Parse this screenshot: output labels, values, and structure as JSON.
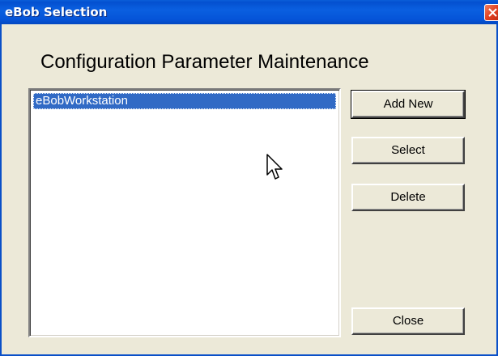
{
  "window": {
    "title": "eBob Selection"
  },
  "heading": "Configuration Parameter Maintenance",
  "list": {
    "items": [
      {
        "label": "eBobWorkstation",
        "selected": true
      }
    ]
  },
  "buttons": {
    "add_new": "Add New",
    "select": "Select",
    "delete": "Delete",
    "close": "Close"
  },
  "colors": {
    "titlebar": "#0a5fd8",
    "window_bg": "#ece9d8",
    "selection": "#316ac5",
    "close_button": "#e04020"
  },
  "icons": {
    "close": "close-icon",
    "cursor": "mouse-pointer-icon"
  }
}
